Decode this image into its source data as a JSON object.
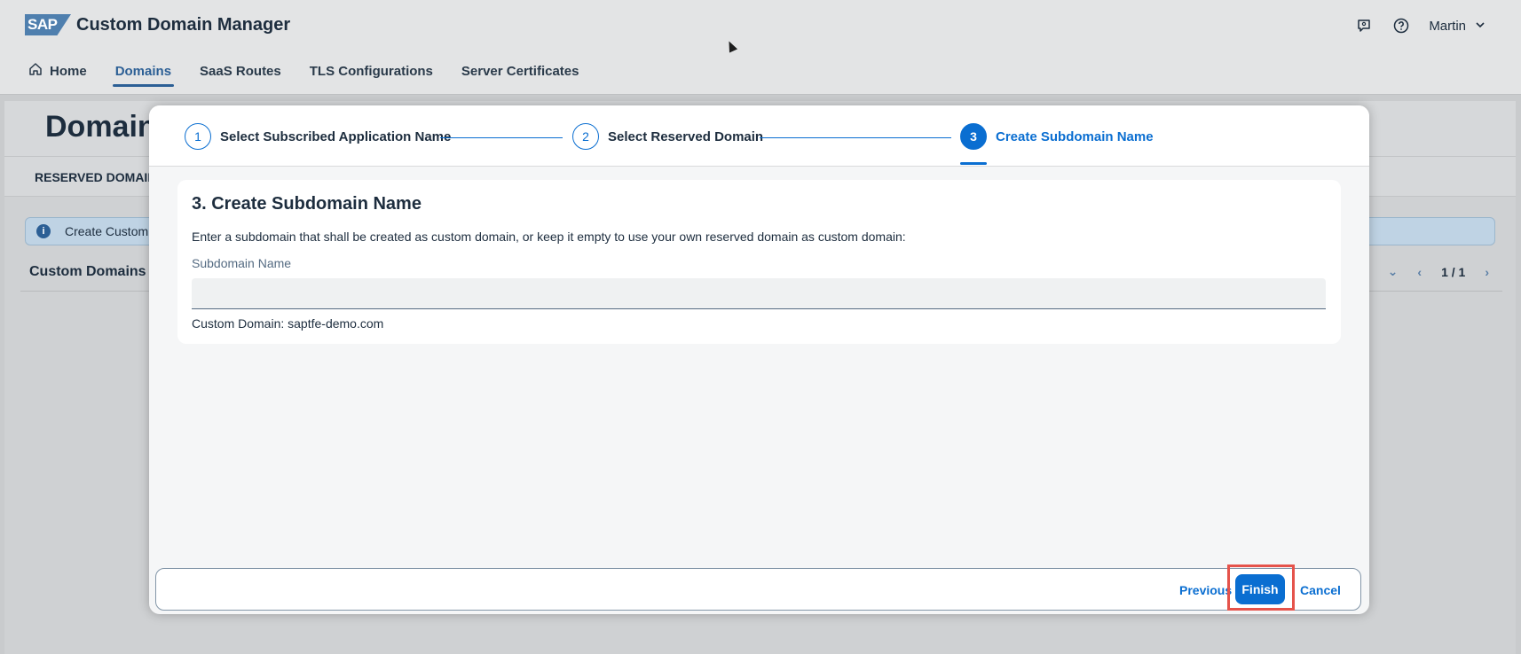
{
  "shell": {
    "logo_text": "SAP",
    "app_title": "Custom Domain Manager",
    "user_name": "Martin",
    "nav": [
      {
        "label": "Home",
        "icon": "home-icon"
      },
      {
        "label": "Domains",
        "active": true
      },
      {
        "label": "SaaS Routes"
      },
      {
        "label": "TLS Configurations"
      },
      {
        "label": "Server Certificates"
      }
    ]
  },
  "background_page": {
    "title": "Domain",
    "tab_label": "RESERVED DOMAIN",
    "info_text": "Create Custom I",
    "table_title": "Custom Domains",
    "pager_text": "1 / 1"
  },
  "wizard": {
    "steps": [
      {
        "number": "1",
        "label": "Select Subscribed Application Name"
      },
      {
        "number": "2",
        "label": "Select Reserved Domain"
      },
      {
        "number": "3",
        "label": "Create Subdomain Name",
        "current": true
      }
    ],
    "section_title": "3. Create Subdomain Name",
    "description": "Enter a subdomain that shall be created as custom domain, or keep it empty to use your own reserved domain as custom domain:",
    "field_label": "Subdomain Name",
    "field_value": "",
    "custom_domain_text": "Custom Domain: saptfe-demo.com",
    "footer": {
      "previous_label": "Previous",
      "finish_label": "Finish",
      "cancel_label": "Cancel"
    }
  },
  "colors": {
    "accent": "#0a6ed1",
    "highlight": "#e5534b"
  }
}
